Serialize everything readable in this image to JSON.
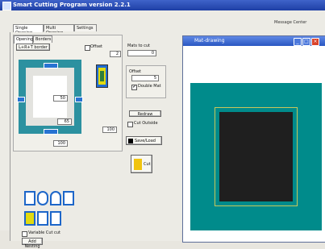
{
  "window": {
    "title": "Smart Cutting Program version 2.2.1"
  },
  "top_right": {
    "label": "Message Center"
  },
  "tabs": [
    "Single Opening",
    "Multi Opening",
    "Settings"
  ],
  "opening": {
    "group_tabs": [
      "Opening",
      "Borders"
    ],
    "button_label": "L+R+T border",
    "offset_label": "Offset",
    "offset_value": "2",
    "field_top": "50",
    "field_mid": "65",
    "field_right": "100",
    "field_bottom": "100"
  },
  "mats": {
    "label": "Mats to cut",
    "value": "0"
  },
  "offset": {
    "label": "Offset",
    "value": "5",
    "double_mat_label": "Double Mat"
  },
  "buttons": {
    "redraw": "Redraw",
    "cut_outside": "Cut Outside",
    "save_load": "Save/Load",
    "cut": "Cut"
  },
  "variable_cut_label": "Variable Cut cut",
  "add_nesting_label": "Add Nesting",
  "mat_window": {
    "title": "Mat-drawing"
  }
}
